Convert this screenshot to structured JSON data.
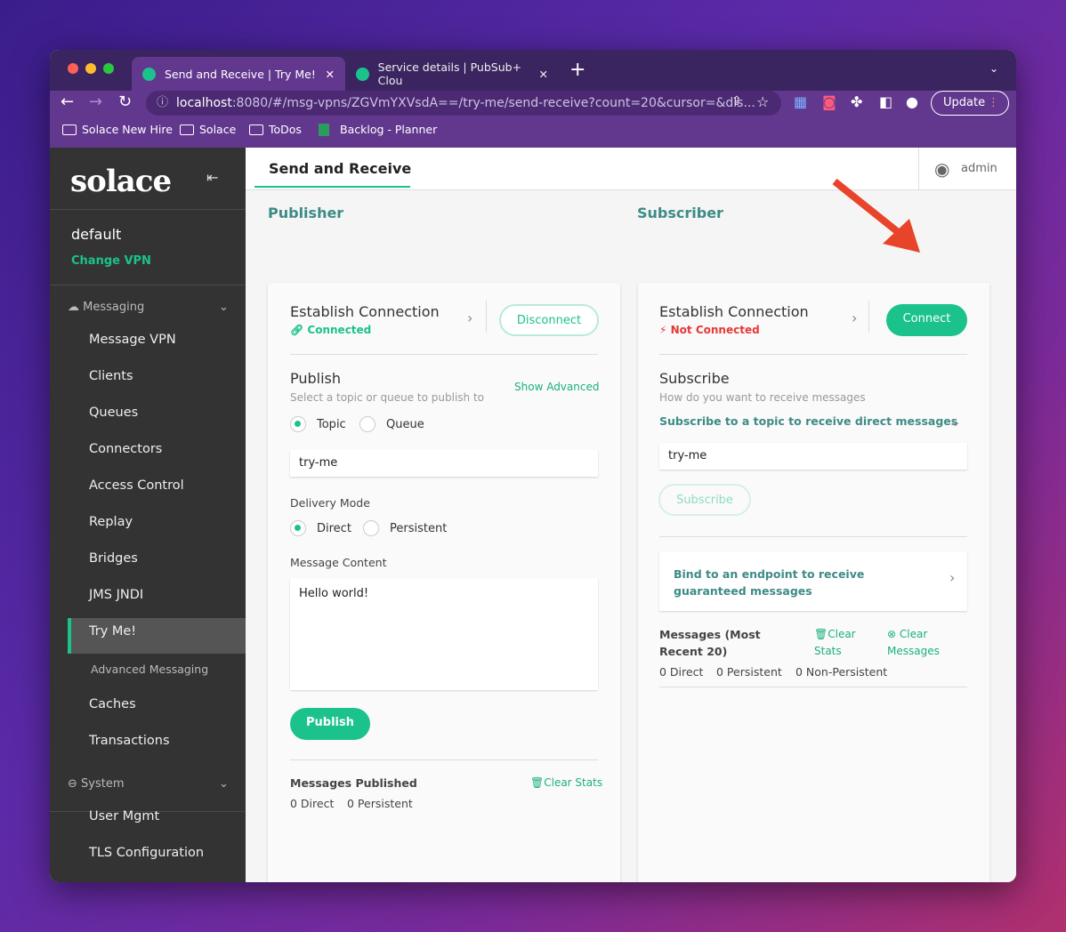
{
  "browser": {
    "tabs": [
      {
        "title": "Send and Receive | Try Me!"
      },
      {
        "title": "Service details | PubSub+ Clou"
      }
    ],
    "url_host": "localhost",
    "url_rest": ":8080/#/msg-vpns/ZGVmYXVsdA==/try-me/send-receive?count=20&cursor=&dis...",
    "update_label": "Update",
    "bookmarks": [
      "Solace New Hire",
      "Solace",
      "ToDos",
      "Backlog - Planner"
    ]
  },
  "sidebar": {
    "logo": "solace",
    "vpn": "default",
    "change_vpn": "Change VPN",
    "messaging_label": "Messaging",
    "messaging_items": [
      "Message VPN",
      "Clients",
      "Queues",
      "Connectors",
      "Access Control",
      "Replay",
      "Bridges",
      "JMS JNDI",
      "Try Me!",
      "Advanced Messaging",
      "Caches",
      "Transactions"
    ],
    "active_item": "Try Me!",
    "system_label": "System",
    "system_items": [
      "User Mgmt",
      "TLS Configuration"
    ]
  },
  "header": {
    "tab": "Send and Receive",
    "user": "admin"
  },
  "publisher": {
    "title": "Publisher",
    "establish": "Establish Connection",
    "status": "Connected",
    "disconnect": "Disconnect",
    "publish_title": "Publish",
    "publish_sub": "Select a topic or queue to publish to",
    "show_advanced": "Show Advanced",
    "topic": "Topic",
    "queue": "Queue",
    "dest_value": "try-me",
    "delivery_mode": "Delivery Mode",
    "direct": "Direct",
    "persistent": "Persistent",
    "message_content": "Message Content",
    "content_value": "Hello world!",
    "publish_btn": "Publish",
    "messages_published": "Messages Published",
    "clear_stats": "Clear Stats",
    "direct_count": "0 Direct",
    "persistent_count": "0 Persistent"
  },
  "subscriber": {
    "title": "Subscriber",
    "establish": "Establish Connection",
    "status": "Not Connected",
    "connect": "Connect",
    "subscribe_title": "Subscribe",
    "subscribe_sub": "How do you want to receive messages",
    "mode": "Subscribe to a topic to receive direct messages",
    "topic_value": "try-me",
    "subscribe_btn": "Subscribe",
    "bind": "Bind to an endpoint to receive guaranteed messages",
    "messages_label": "Messages  (Most Recent 20)",
    "clear_stats": "Clear Stats",
    "clear_messages": "Clear Messages",
    "direct_count": "0 Direct",
    "persistent_count": "0 Persistent",
    "nonpersistent_count": "0 Non-Persistent"
  },
  "colors": {
    "accent": "#1bc28c",
    "teal_text": "#3d8b86",
    "error": "#e53935",
    "annotation_arrow": "#e8442a"
  }
}
